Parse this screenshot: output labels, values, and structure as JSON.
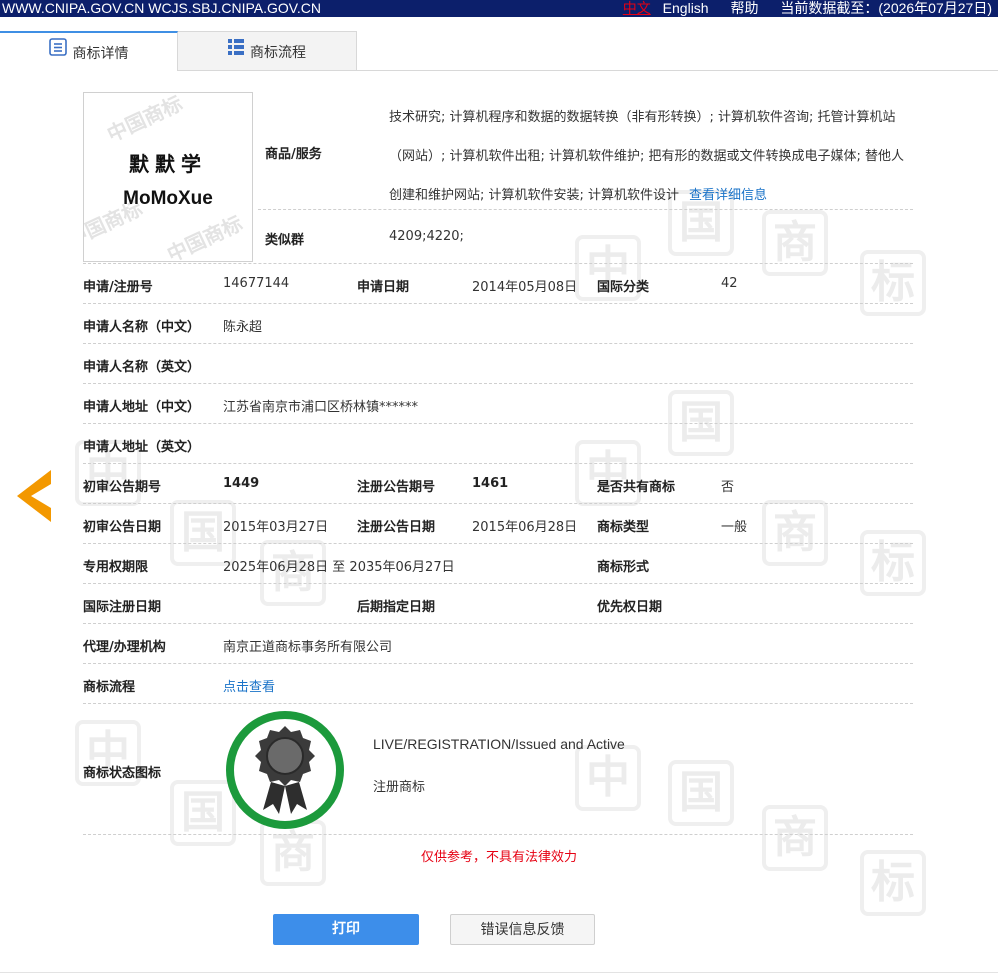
{
  "topbar": {
    "site": "WWW.CNIPA.GOV.CN WCJS.SBJ.CNIPA.GOV.CN",
    "lang_zh": "中文",
    "lang_en": "English",
    "help": "帮助",
    "data_date": "当前数据截至：(2026年07月27日)"
  },
  "tabs": [
    {
      "label": "商标详情",
      "active": true,
      "icon": "document-list-icon"
    },
    {
      "label": "商标流程",
      "active": false,
      "icon": "grid-list-icon"
    }
  ],
  "trademark": {
    "image_cn": "默默学",
    "image_en": "MoMoXue",
    "watermark": "中国商标"
  },
  "goods": {
    "label": "商品/服务",
    "text": "技术研究; 计算机程序和数据的数据转换（非有形转换）; 计算机软件咨询; 托管计算机站（网站）; 计算机软件出租; 计算机软件维护; 把有形的数据或文件转换成电子媒体; 替他人创建和维护网站; 计算机软件安装; 计算机软件设计",
    "detail_link": "查看详细信息"
  },
  "similar_group": {
    "label": "类似群",
    "value": "4209;4220;"
  },
  "fields": {
    "reg_no_label": "申请/注册号",
    "reg_no": "14677144",
    "apply_date_label": "申请日期",
    "apply_date": "2014年05月08日",
    "intl_class_label": "国际分类",
    "intl_class": "42",
    "applicant_cn_label": "申请人名称（中文）",
    "applicant_cn": "陈永超",
    "applicant_en_label": "申请人名称（英文）",
    "applicant_en": "",
    "address_cn_label": "申请人地址（中文）",
    "address_cn": "江苏省南京市浦口区桥林镇******",
    "address_en_label": "申请人地址（英文）",
    "address_en": "",
    "prelim_no_label": "初审公告期号",
    "prelim_no": "1449",
    "reg_pub_no_label": "注册公告期号",
    "reg_pub_no": "1461",
    "shared_label": "是否共有商标",
    "shared": "否",
    "prelim_date_label": "初审公告日期",
    "prelim_date": "2015年03月27日",
    "reg_pub_date_label": "注册公告日期",
    "reg_pub_date": "2015年06月28日",
    "tm_type_label": "商标类型",
    "tm_type": "一般",
    "exclusive_label": "专用权期限",
    "exclusive": "2025年06月28日 至 2035年06月27日",
    "tm_form_label": "商标形式",
    "tm_form": "",
    "intl_reg_date_label": "国际注册日期",
    "intl_reg_date": "",
    "later_date_label": "后期指定日期",
    "later_date": "",
    "priority_label": "优先权日期",
    "priority": "",
    "agent_label": "代理/办理机构",
    "agent": "南京正道商标事务所有限公司",
    "process_label": "商标流程",
    "process_link": "点击查看",
    "status_icon_label": "商标状态图标"
  },
  "status": {
    "en": "LIVE/REGISTRATION/Issued and Active",
    "cn": "注册商标",
    "seal_color": "#1c9a3c",
    "icon": "award-ribbon-icon"
  },
  "disclaimer": "仅供参考，不具有法律效力",
  "buttons": {
    "print": "打印",
    "feedback": "错误信息反馈"
  },
  "colors": {
    "topbar": "#0c1f6b",
    "accent": "#3d8eea",
    "arrow": "#f39800",
    "warning": "#e60012",
    "link": "#1a73c8"
  }
}
